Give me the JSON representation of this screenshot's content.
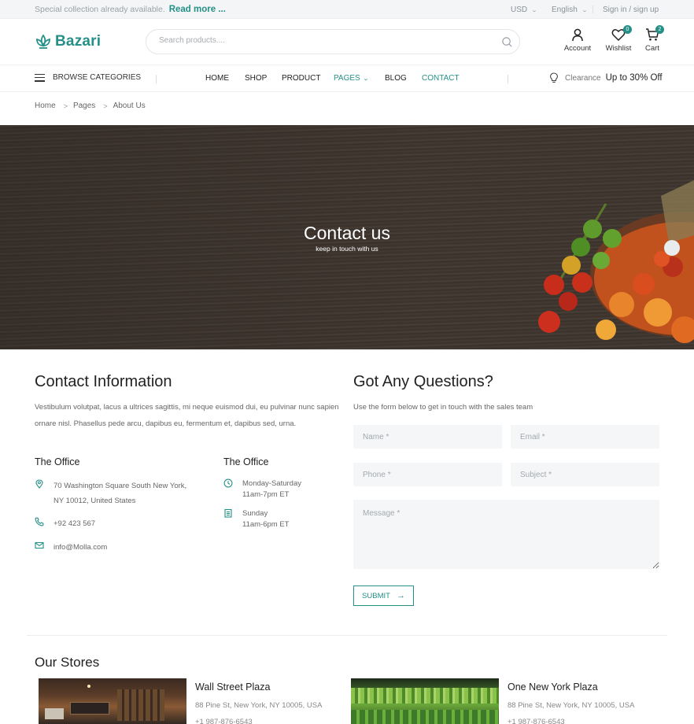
{
  "topbar": {
    "promo_text": "Special collection already available.",
    "promo_link": "Read more ...",
    "currency": "USD",
    "language": "English",
    "signin": "Sign in / sign up"
  },
  "header": {
    "logo": "Bazari",
    "search_placeholder": "Search products....",
    "account_label": "Account",
    "wishlist_label": "Wishlist",
    "wishlist_count": "0",
    "cart_label": "Cart",
    "cart_count": "2"
  },
  "nav": {
    "browse": "BROWSE CATEGORIES",
    "items": [
      "HOME",
      "SHOP",
      "PRODUCT",
      "PAGES",
      "BLOG",
      "CONTACT"
    ],
    "clearance_label": "Clearance",
    "clearance_offer": "Up to 30% Off"
  },
  "breadcrumb": [
    "Home",
    "Pages",
    "About Us"
  ],
  "hero": {
    "title": "Contact us",
    "subtitle": "keep in touch with us"
  },
  "contact_info": {
    "title": "Contact Information",
    "text": "Vestibulum volutpat, lacus a ultrices sagittis, mi neque euismod dui, eu pulvinar nunc sapien ornare nisl. Phasellus pede arcu, dapibus eu, fermentum et, dapibus sed, urna.",
    "office1": {
      "title": "The Office",
      "address_line1": "70 Washington Square South New York,",
      "address_line2": "NY 10012, United States",
      "phone": "+92 423 567",
      "email": "info@Molla.com"
    },
    "office2": {
      "title": "The Office",
      "hours1_days": "Monday-Saturday",
      "hours1_time": "11am-7pm ET",
      "hours2_days": "Sunday",
      "hours2_time": "11am-6pm ET"
    }
  },
  "form": {
    "title": "Got Any Questions?",
    "intro": "Use the form below to get in touch with the sales team",
    "name_placeholder": "Name *",
    "email_placeholder": "Email *",
    "phone_placeholder": "Phone *",
    "subject_placeholder": "Subject *",
    "message_placeholder": "Message *",
    "submit": "SUBMIT"
  },
  "stores": {
    "title": "Our Stores",
    "items": [
      {
        "name": "Wall Street Plaza",
        "address": "88 Pine St, New York, NY 10005, USA",
        "phone": "+1 987-876-6543"
      },
      {
        "name": "One New York Plaza",
        "address": "88 Pine St, New York, NY 10005, USA",
        "phone": "+1 987-876-6543"
      }
    ]
  },
  "colors": {
    "accent": "#249087",
    "topbar_bg": "#f4f5f7",
    "field_bg": "#f5f6f7",
    "hero_wood": "#3d342e"
  }
}
